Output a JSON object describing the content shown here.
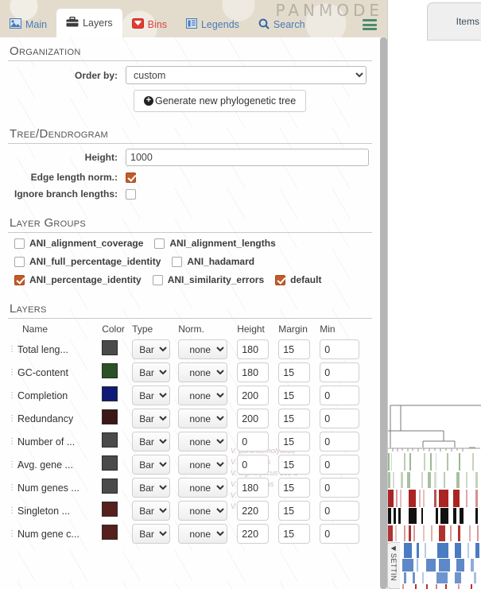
{
  "app": {
    "brand": "PANMODE"
  },
  "tabbar": {
    "tabs": [
      {
        "id": "main",
        "label": "Main",
        "icon": "image-icon",
        "active": false
      },
      {
        "id": "layers",
        "label": "Layers",
        "icon": "briefcase-icon",
        "active": true
      },
      {
        "id": "bins",
        "label": "Bins",
        "icon": "bin-icon",
        "active": false
      },
      {
        "id": "legends",
        "label": "Legends",
        "icon": "list-icon",
        "active": false
      },
      {
        "id": "search",
        "label": "Search",
        "icon": "search-icon",
        "active": false
      }
    ],
    "menu_icon": "hamburger-icon"
  },
  "organization": {
    "title": "Organization",
    "order_by": {
      "label": "Order by:",
      "value": "custom",
      "options": [
        "custom"
      ]
    },
    "generate_button": {
      "label": "Generate new phylogenetic tree",
      "icon": "plus-circle-icon"
    }
  },
  "tree": {
    "title": "Tree/Dendrogram",
    "height": {
      "label": "Height:",
      "value": "1000"
    },
    "edge_length_norm": {
      "label": "Edge length norm.:",
      "checked": true
    },
    "ignore_branch_lengths": {
      "label": "Ignore branch lengths:",
      "checked": false
    }
  },
  "layer_groups": {
    "title": "Layer Groups",
    "items": [
      {
        "label": "ANI_alignment_coverage",
        "checked": false
      },
      {
        "label": "ANI_alignment_lengths",
        "checked": false
      },
      {
        "label": "ANI_full_percentage_identity",
        "checked": false
      },
      {
        "label": "ANI_hadamard",
        "checked": false
      },
      {
        "label": "ANI_percentage_identity",
        "checked": true
      },
      {
        "label": "ANI_similarity_errors",
        "checked": false
      },
      {
        "label": "default",
        "checked": true
      }
    ]
  },
  "layers": {
    "title": "Layers",
    "columns": [
      "Name",
      "Color",
      "Type",
      "Norm.",
      "Height",
      "Margin",
      "Min"
    ],
    "rows": [
      {
        "name": "Total leng...",
        "color": "#4a4a4a",
        "type": "Bar",
        "norm": "none",
        "height": "180",
        "margin": "15",
        "min": "0"
      },
      {
        "name": "GC-content",
        "color": "#2b5226",
        "type": "Bar",
        "norm": "none",
        "height": "180",
        "margin": "15",
        "min": "0"
      },
      {
        "name": "Completion",
        "color": "#101a78",
        "type": "Bar",
        "norm": "none",
        "height": "200",
        "margin": "15",
        "min": "0"
      },
      {
        "name": "Redundancy",
        "color": "#3d1616",
        "type": "Bar",
        "norm": "none",
        "height": "200",
        "margin": "15",
        "min": "0"
      },
      {
        "name": "Number of ...",
        "color": "#4a4a4a",
        "type": "Bar",
        "norm": "none",
        "height": "0",
        "margin": "15",
        "min": "0"
      },
      {
        "name": "Avg. gene ...",
        "color": "#4a4a4a",
        "type": "Bar",
        "norm": "none",
        "height": "0",
        "margin": "15",
        "min": "0"
      },
      {
        "name": "Num genes ...",
        "color": "#4a4a4a",
        "type": "Bar",
        "norm": "none",
        "height": "180",
        "margin": "15",
        "min": "0"
      },
      {
        "name": "Singleton ...",
        "color": "#57201d",
        "type": "Bar",
        "norm": "none",
        "height": "220",
        "margin": "15",
        "min": "0"
      },
      {
        "name": "Num gene c...",
        "color": "#57201d",
        "type": "Bar",
        "norm": "none",
        "height": "220",
        "margin": "15",
        "min": "0"
      }
    ]
  },
  "viz": {
    "items_order_tab": "Items orde",
    "settings_handle": {
      "label": "SETTIN",
      "arrow": "◀"
    },
    "ghost_labels": [
      "V. parahaemolyticus",
      "V. diabolicus",
      "V. alginolyticus 138-2",
      "V. antiquarius",
      "V. furnissii",
      "V. vulnificus"
    ]
  }
}
